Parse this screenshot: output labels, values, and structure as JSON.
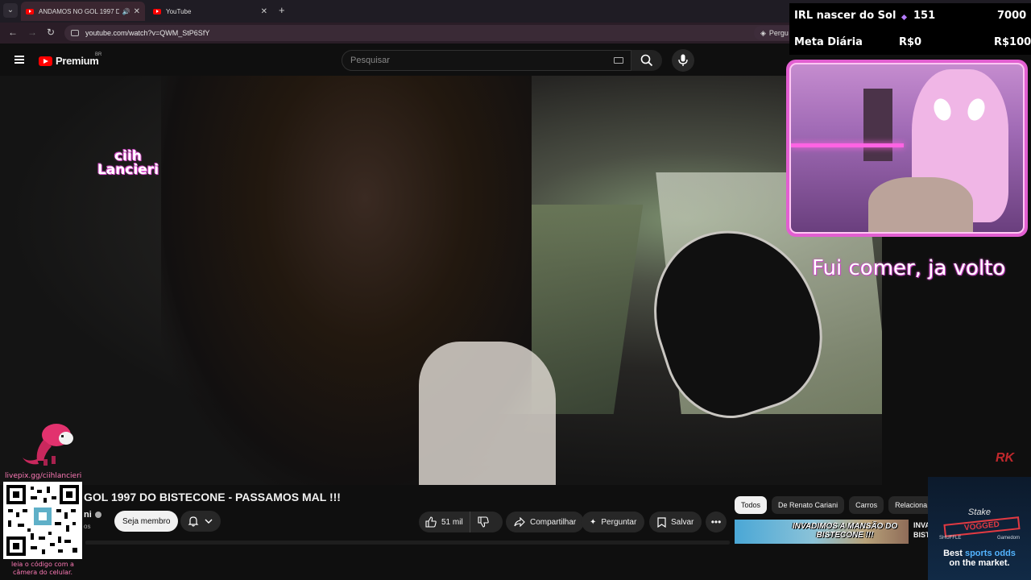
{
  "browser": {
    "tabs": [
      {
        "title": "ANDAMOS NO GOL 1997 D",
        "active": true,
        "audio": true
      },
      {
        "title": "YouTube",
        "active": false,
        "audio": false
      }
    ],
    "url": "youtube.com/watch?v=QWM_StP6SfY",
    "ask_label": "Pergu"
  },
  "masthead": {
    "logo_text": "Premium",
    "logo_region": "BR",
    "search_placeholder": "Pesquisar"
  },
  "video": {
    "title": "GOL 1997 DO BISTECONE - PASSAMOS MAL !!!",
    "channel_name": "ni",
    "channel_subs": "os",
    "member_label": "Seja membro",
    "like_count": "51 mil",
    "share_label": "Compartilhar",
    "ask_label": "Perguntar",
    "save_label": "Salvar",
    "watermark": "RK"
  },
  "related": {
    "chips": [
      "Todos",
      "De Renato Cariani",
      "Carros",
      "Relaciona"
    ],
    "first_thumb_text": "INVADIMOS A MANSÃO DO BISTECONE !!!",
    "first_title": "INVA BIST"
  },
  "stream_overlay": {
    "stats": {
      "row1_label": "IRL nascer do Sol",
      "row1_count": "151",
      "row1_goal": "7000",
      "row2_label": "Meta Diária",
      "row2_current": "R$0",
      "row2_goal": "R$100"
    },
    "streamer_name_line1": "ciih",
    "streamer_name_line2": "Lancieri",
    "brb_text": "Fui comer, ja volto",
    "livepix_url": "livepix.gg/ciihlancieri",
    "qr_caption": "leia o código com a câmera do celular."
  },
  "ad": {
    "brand": "Stake",
    "stamp": "VOGGED",
    "sub_left": "SHUFFLE",
    "sub_right": "Gamedom",
    "line1_pre": "Best ",
    "line1_accent": "sports odds",
    "line2": "on the market."
  },
  "colors": {
    "youtube_red": "#ff0000",
    "overlay_pink": "#e25fd1",
    "livepix_pink": "#ff7ab7",
    "background": "#0f0f0f"
  }
}
